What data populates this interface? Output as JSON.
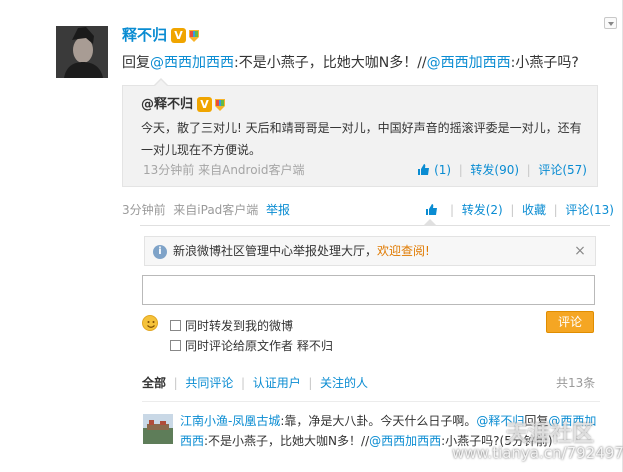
{
  "post": {
    "username": "释不归",
    "v_badge": "V",
    "reply_prefix": "回复",
    "reply_mention": "@西西加西西",
    "reply_body": ":不是小燕子，比她大咖N多！//",
    "reply_mention2": "@西西加西西",
    "reply_tail": ":小燕子吗?",
    "time": "3分钟前",
    "source": "来自iPad客户端",
    "report": "举报",
    "like_icon": "thumbs-up-icon",
    "repost": "转发(2)",
    "favorite": "收藏",
    "comment": "评论(13)"
  },
  "quote": {
    "author": "@释不归",
    "v_badge": "V",
    "text": "今天，散了三对儿! 天后和靖哥哥是一对儿，中国好声音的摇滚评委是一对儿，还有一对儿现在不方便说。",
    "time": "13分钟前",
    "source": "来自Android客户端",
    "likes": "(1)",
    "repost": "转发(90)",
    "comment": "评论(57)"
  },
  "comment_panel": {
    "notice_text": "新浪微博社区管理中心举报处理大厅，",
    "notice_link": "欢迎查阅!",
    "close_glyph": "×",
    "input_value": "",
    "option_repost": "同时转发到我的微博",
    "option_comment": "同时评论给原文作者 释不归",
    "submit_label": "评论",
    "filters": [
      "全部",
      "共同评论",
      "认证用户",
      "关注的人"
    ],
    "total": "共13条"
  },
  "comment": {
    "author": "江南小渔-凤凰古城",
    "text_a": ":靠，净是大八卦。今天什么日子啊。",
    "mention_a": "@释不归",
    "text_b": "回复",
    "mention_b": "@西西加西西",
    "text_c": ":不是小燕子，比她大咖N多！//",
    "mention_c": "@西西加西西",
    "text_d": ":小燕子吗?(5分钟前)"
  },
  "watermark": {
    "url": "www.tianya.cn/79249722",
    "logo": "天涯社区"
  },
  "colors": {
    "link": "#0a8cd2",
    "accent": "#f5a623",
    "badge": "#f0a500"
  }
}
